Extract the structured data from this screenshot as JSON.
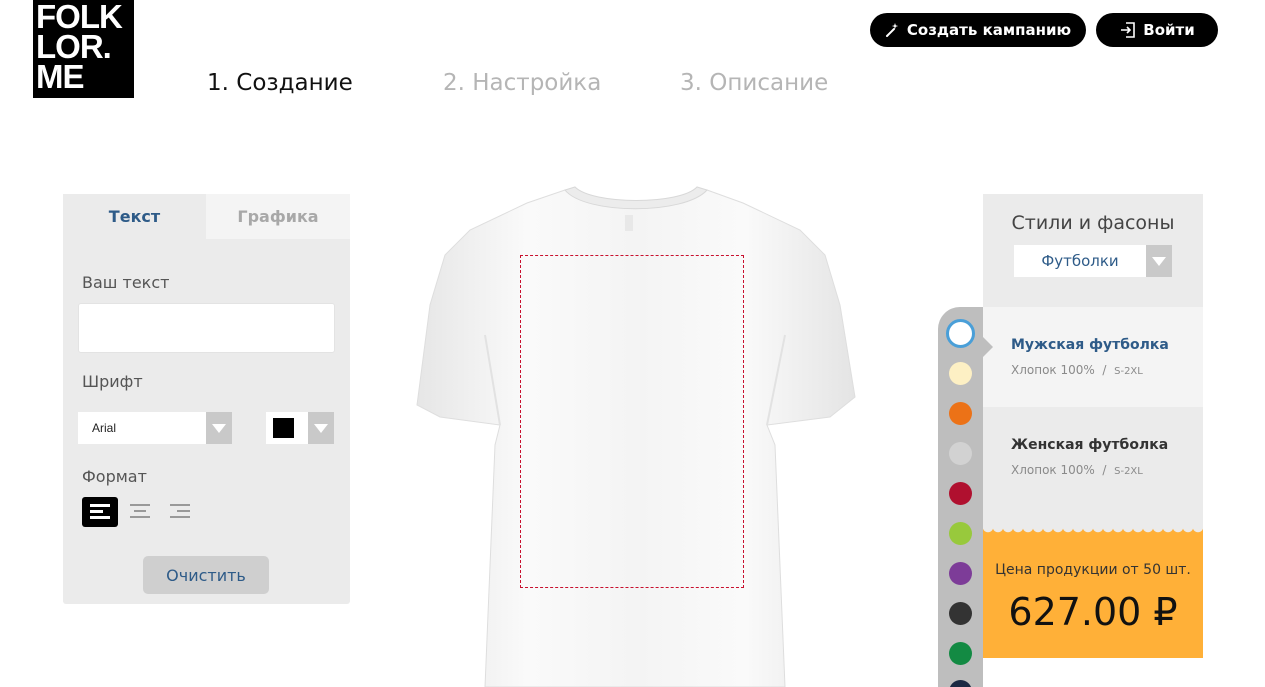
{
  "logo": {
    "line1": "FOLK",
    "line2": "LOR.",
    "line3": "ME"
  },
  "steps": [
    "1. Создание",
    "2. Настройка",
    "3. Описание"
  ],
  "header": {
    "create_campaign": "Создать кампанию",
    "login": "Войти",
    "campaign_icon": "magic-wand-icon",
    "login_icon": "login-icon"
  },
  "editor": {
    "tabs": [
      "Текст",
      "Графика"
    ],
    "text_label": "Ваш текст",
    "text_value": "",
    "font_label": "Шрифт",
    "font_value": "Arial",
    "color_value": "#000000",
    "format_label": "Формат",
    "align_options": [
      "align-left-icon",
      "align-center-icon",
      "align-right-icon"
    ],
    "clear_button": "Очистить"
  },
  "colors": [
    "#ffffff",
    "#fdf0c4",
    "#ec7217",
    "#d2d2d2",
    "#b0102f",
    "#98c93c",
    "#7d3c98",
    "#333333",
    "#138a43",
    "#1b2a44"
  ],
  "styles": {
    "title": "Стили и фасоны",
    "type_value": "Футболки",
    "products": [
      {
        "name": "Мужская футболка",
        "desc": "Хлопок 100%",
        "sizes": "S-2XL"
      },
      {
        "name": "Женская футболка",
        "desc": "Хлопок 100%",
        "sizes": "S-2XL"
      }
    ]
  },
  "price": {
    "label": "Цена продукции от 50 шт.",
    "value": "627.00 ₽"
  },
  "accent_colors": {
    "tab_active": "#2e5b88",
    "price_bg": "#ffb038",
    "selected_ring": "#4a9fd8"
  }
}
